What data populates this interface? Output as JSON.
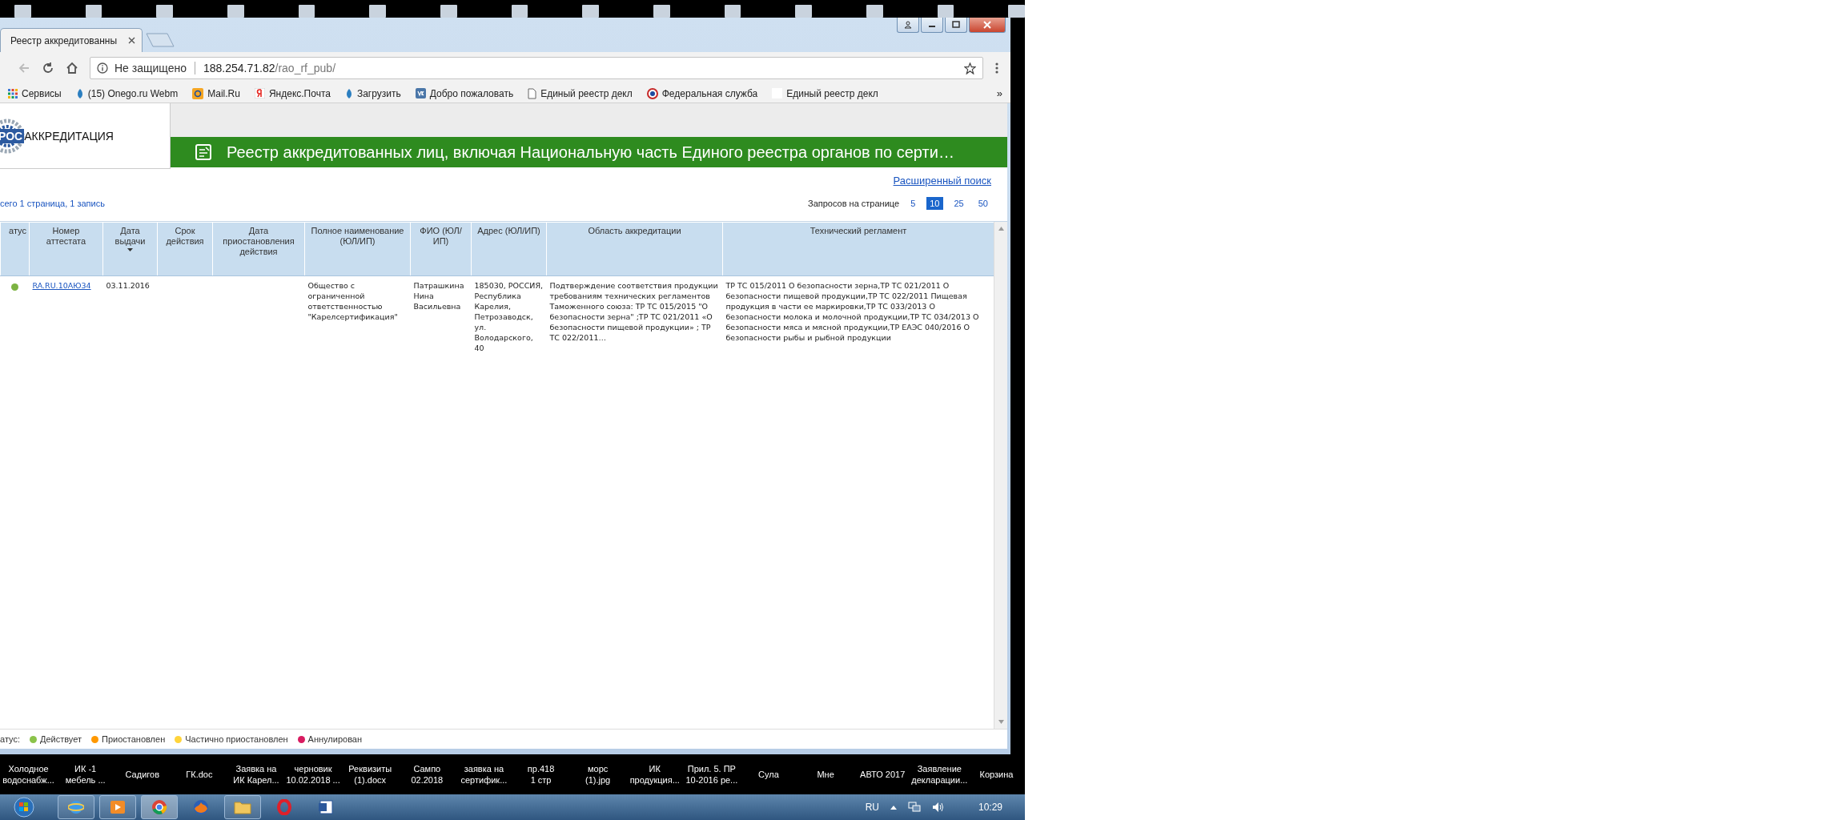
{
  "browser": {
    "tabs": [
      {
        "label": "Реестр аккредитованны",
        "selected": true
      }
    ],
    "address_bar": {
      "security": "Не защищено",
      "url_host": "188.254.71.82",
      "url_path": "/rao_rf_pub/"
    },
    "bookmarks": [
      {
        "label": "Сервисы",
        "kind": "apps"
      },
      {
        "label": "(15) Onego.ru Webm",
        "kind": "leaf"
      },
      {
        "label": "Mail.Ru",
        "kind": "mail"
      },
      {
        "label": "Яндекс.Почта",
        "kind": "tile"
      },
      {
        "label": "Загрузить",
        "kind": "leaf"
      },
      {
        "label": "Добро пожаловать",
        "kind": "square"
      },
      {
        "label": "Единый реестр декл",
        "kind": "doc"
      },
      {
        "label": "Федеральная служба",
        "kind": "emblem"
      },
      {
        "label": "Единый реестр декл",
        "kind": "blank"
      }
    ],
    "bookmarks_more": "»"
  },
  "site": {
    "logo_prefix": "РОС",
    "logo_rest": "АККРЕДИТАЦИЯ",
    "banner_title": "Реестр аккредитованных лиц, включая Национальную часть Единого реестра органов по серти…"
  },
  "advanced_search": "Расширенный поиск",
  "summary": "сего 1 страница, 1 запись",
  "page_size": {
    "label": "Запросов на странице",
    "options": [
      {
        "label": "5",
        "selected": false
      },
      {
        "label": "10",
        "selected": true
      },
      {
        "label": "25",
        "selected": false
      },
      {
        "label": "50",
        "selected": false
      }
    ]
  },
  "table": {
    "columns": [
      {
        "label": "атус",
        "sorted": false
      },
      {
        "label": "Номер аттестата",
        "sorted": false
      },
      {
        "label": "Дата выдачи",
        "sorted": true
      },
      {
        "label": "Срок действия",
        "sorted": false
      },
      {
        "label": "Дата приостановления действия",
        "sorted": false
      },
      {
        "label": "Полное наименование (ЮЛ/ИП)",
        "sorted": false
      },
      {
        "label": "ФИО (ЮЛ/ИП)",
        "sorted": false
      },
      {
        "label": "Адрес (ЮЛ/ИП)",
        "sorted": false
      },
      {
        "label": "Область аккредитации",
        "sorted": false
      },
      {
        "label": "Технический регламент",
        "sorted": false
      }
    ],
    "rows": [
      {
        "color": "#7cb342",
        "certificate": "RA.RU.10АЮ34",
        "issue_date": "03.11.2016",
        "full_name": "Общество с ограниченной ответственностью \"Карелсертификация\"",
        "fio": "Патрашкина Нина Васильевна",
        "address": "185030, РОССИЯ, Республика Карелия, Петрозаводск, ул. Володарского, 40",
        "scope": "Подтверждение соответствия продукции требованиям технических регламентов Таможенного союза: ТР ТС 015/2015 \"О безопасности зерна\" ;ТР ТС 021/2011 «О безопасности пищевой продукции» ; ТР ТС 022/2011…",
        "regulation": "ТР ТС 015/2011 О безопасности зерна,ТР ТС 021/2011 О безопасности пищевой продукции,ТР ТС 022/2011 Пищевая продукция в части ее маркировки,ТР ТС 033/2013 О безопасности молока и молочной продукции,ТР ТС 034/2013 О безопасности мяса и мясной продукции,ТР ЕАЭС 040/2016 О безопасности рыбы и рыбной продукции"
      }
    ]
  },
  "legend": {
    "label": "атус:",
    "items": [
      {
        "label": "Действует",
        "color": "#8bc34a"
      },
      {
        "label": "Приостановлен",
        "color": "#ff9800"
      },
      {
        "label": "Частично приостановлен",
        "color": "#ffd43b"
      },
      {
        "label": "Аннулирован",
        "color": "#d81b60"
      }
    ]
  },
  "desktop_icons": [
    {
      "label": "Холодное\nводоснабж..."
    },
    {
      "label": "ИК -1\nмебель ..."
    },
    {
      "label": "Садигов"
    },
    {
      "label": "ГК.doc"
    },
    {
      "label": "Заявка на\nИК Карел..."
    },
    {
      "label": "черновик\n10.02.2018 ..."
    },
    {
      "label": "Реквизиты\n(1).docx"
    },
    {
      "label": "Сампо\n02.2018"
    },
    {
      "label": "заявка на\nсертифик..."
    },
    {
      "label": "пр.418\n1 стр"
    },
    {
      "label": "морс\n(1).jpg"
    },
    {
      "label": "ИК\nпродукция..."
    },
    {
      "label": "Прил. 5.  ПР\n10-2016 ре..."
    },
    {
      "label": "Сула"
    },
    {
      "label": "Мне"
    },
    {
      "label": "АВТО 2017"
    },
    {
      "label": "Заявление\nдекларации..."
    },
    {
      "label": "Корзина"
    }
  ],
  "taskbar": {
    "apps": [
      {
        "kind": "globe",
        "open": true,
        "selected": false
      },
      {
        "kind": "play",
        "open": true,
        "selected": false
      },
      {
        "kind": "chrome",
        "open": true,
        "selected": true
      },
      {
        "kind": "fox",
        "open": false,
        "selected": false
      },
      {
        "kind": "folder",
        "open": true,
        "selected": false
      },
      {
        "kind": "ring",
        "open": false,
        "selected": false
      },
      {
        "kind": "doc",
        "open": false,
        "selected": false
      }
    ],
    "language": "RU",
    "time": "10:29"
  }
}
